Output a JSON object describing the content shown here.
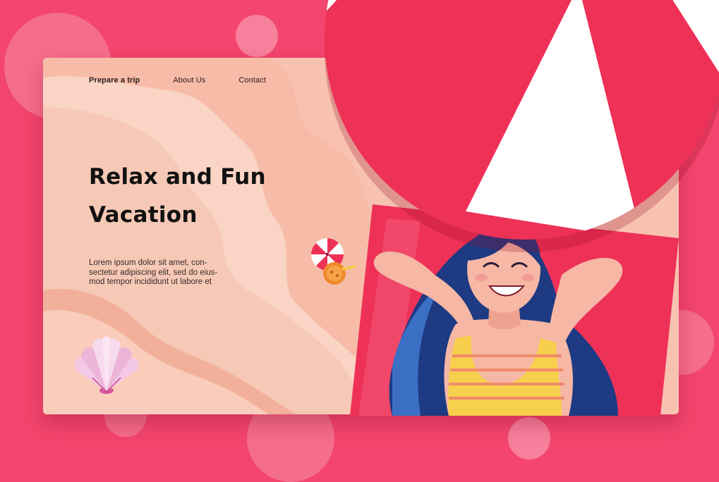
{
  "nav": {
    "items": [
      {
        "label": "Prepare a trip",
        "active": true
      },
      {
        "label": "About Us",
        "active": false
      },
      {
        "label": "Contact",
        "active": false
      }
    ]
  },
  "hero": {
    "title_line1": "Relax and Fun",
    "title_line2": "Vacation",
    "body_line1": "Lorem ipsum dolor sit amet, con-",
    "body_line2": "sectetur adipiscing elit, sed do eius-",
    "body_line3": "mod tempor incididunt ut labore et"
  },
  "colors": {
    "background": "#f3456d",
    "sand": "#f8c2b0",
    "towel": "#ee3157",
    "hair": "#1d3a82",
    "swimsuit": "#f6d04c"
  },
  "icons": [
    "shell-icon",
    "beach-umbrella-icon",
    "cocktail-icon",
    "umbrella-canopy"
  ]
}
